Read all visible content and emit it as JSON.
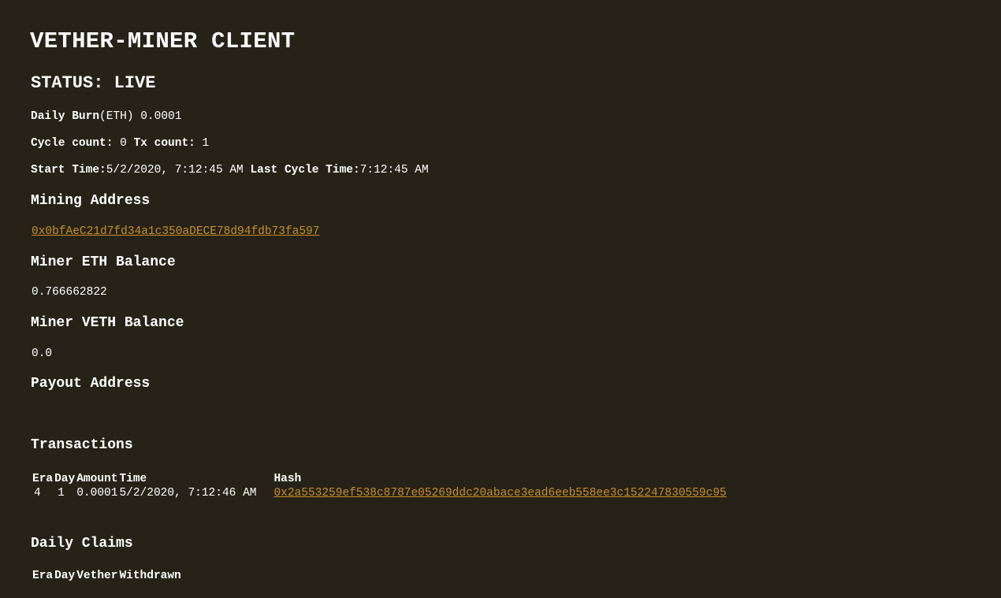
{
  "title": "VETHER-MINER CLIENT",
  "status": "STATUS: LIVE",
  "daily_burn": {
    "label": "Daily Burn",
    "unit": "(ETH)",
    "value": " 0.0001"
  },
  "counts": {
    "cycle_label": "Cycle count:",
    "cycle_value": " 0 ",
    "tx_label": "Tx count:",
    "tx_value": " 1"
  },
  "times": {
    "start_label": "Start Time:",
    "start_value": "5/2/2020, 7:12:45 AM ",
    "last_label": "Last Cycle Time:",
    "last_value": "7:12:45 AM"
  },
  "mining_address": {
    "label": "Mining Address",
    "value": "0x0bfAeC21d7fd34a1c350aDECE78d94fdb73fa597"
  },
  "eth_balance": {
    "label": "Miner ETH Balance",
    "value": "0.766662822"
  },
  "veth_balance": {
    "label": "Miner VETH Balance",
    "value": "0.0"
  },
  "payout_address": {
    "label": "Payout Address",
    "value": ""
  },
  "transactions": {
    "label": "Transactions",
    "columns": [
      "Era",
      "Day",
      "Amount",
      "Time",
      "Hash"
    ],
    "rows": [
      {
        "era": "4",
        "day": "1",
        "amount": "0.0001",
        "time": "5/2/2020, 7:12:46 AM",
        "hash": "0x2a553259ef538c8787e05269ddc20abace3ead6eeb558ee3c152247830559c95"
      }
    ]
  },
  "daily_claims": {
    "label": "Daily Claims",
    "columns": [
      "Era",
      "Day",
      "Vether",
      "Withdrawn"
    ]
  },
  "colors": {
    "background": "#262217",
    "text": "#ffffff",
    "link": "#c89025"
  }
}
